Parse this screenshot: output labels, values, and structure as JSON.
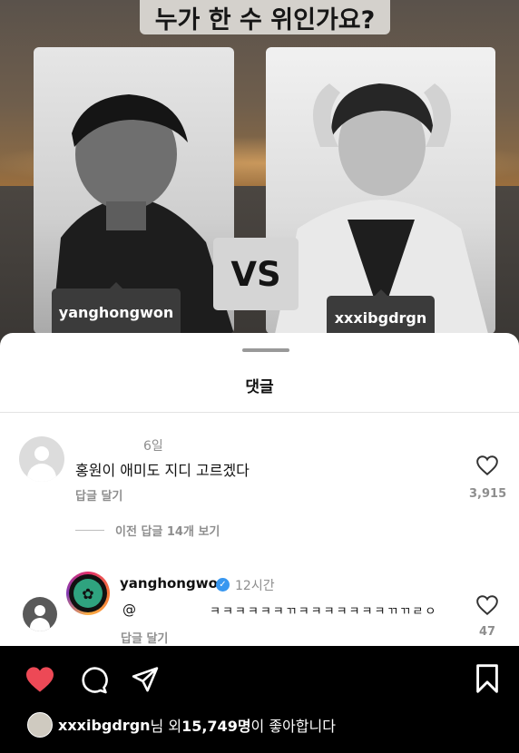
{
  "post": {
    "title": "누가 한 수 위인가요?",
    "vs_label": "VS",
    "left_tag": "yanghongwon",
    "right_tag": "xxxibgdrgn"
  },
  "comments_sheet": {
    "title": "댓글",
    "comment": {
      "time": "6일",
      "text": "홍원이 애미도 지디 고르겠다",
      "reply_label": "답글 달기",
      "like_count": "3,915"
    },
    "view_replies": "이전 답글 14개 보기",
    "reply": {
      "username": "yanghongwon",
      "verified_icon": "✓",
      "time": "12시간",
      "mention": "@",
      "text": "ㅋㅋㅋㅋㅋㅋㄲㅋㅋㅋㅋㅋㅋㅋㄲㄲㄹㅇ",
      "reply_label": "답글 달기",
      "like_count": "47"
    }
  },
  "likes": {
    "username": "xxxibgdrgn",
    "middle": "님 외 ",
    "count": "15,749명",
    "suffix": "이 좋아합니다"
  },
  "colors": {
    "heart_liked": "#ed4956",
    "verified": "#3897f0",
    "secondary_text": "#8e8e8e"
  }
}
